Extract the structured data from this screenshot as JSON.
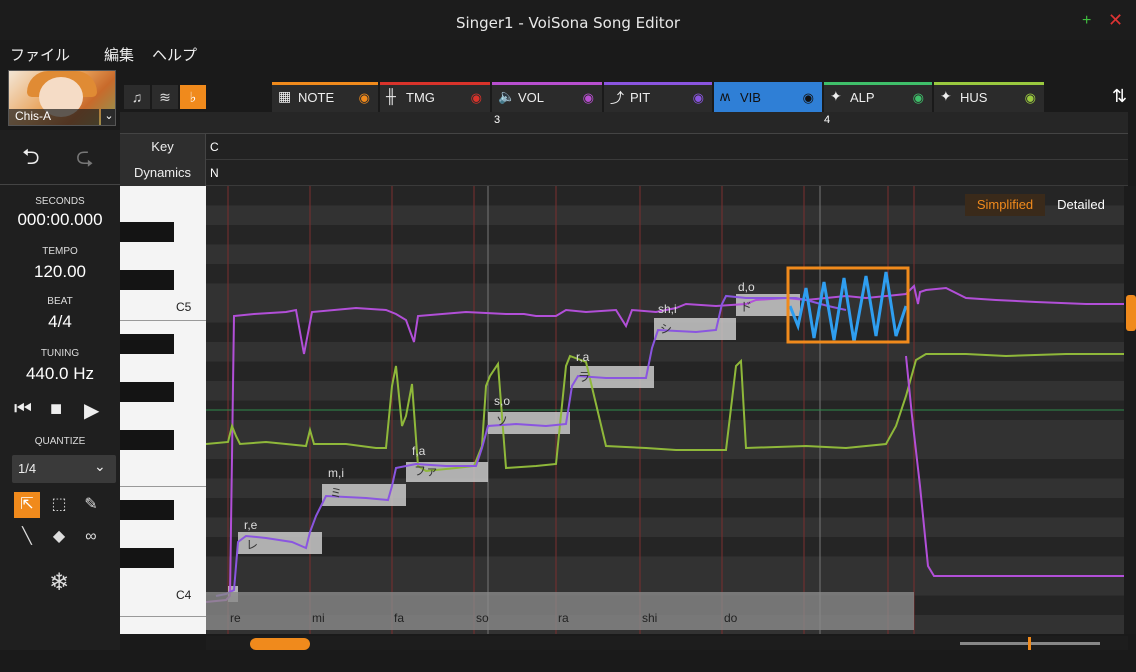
{
  "window": {
    "title": "Singer1 - VoiSona Song Editor"
  },
  "menu": [
    "ファイル",
    "編集",
    "ヘルプ"
  ],
  "singer": {
    "name": "Chis-A"
  },
  "history": {
    "undo_icon": "undo-icon",
    "redo_icon": "redo-icon"
  },
  "transport_info": {
    "seconds_label": "SECONDS",
    "seconds_value": "000:00.000",
    "tempo_label": "TEMPO",
    "tempo_value": "120.00",
    "beat_label": "BEAT",
    "beat_value": "4/4",
    "tuning_label": "TUNING",
    "tuning_value": "440.0 Hz"
  },
  "quantize": {
    "label": "QUANTIZE",
    "value": "1/4"
  },
  "tabs": [
    {
      "label": "NOTE",
      "color": "#f08a1c"
    },
    {
      "label": "TMG",
      "color": "#d9332b"
    },
    {
      "label": "VOL",
      "color": "#b84fd0"
    },
    {
      "label": "PIT",
      "color": "#8a55e0"
    },
    {
      "label": "VIB",
      "color": "#2f7fd6"
    },
    {
      "label": "ALP",
      "color": "#3fbf6a"
    },
    {
      "label": "HUS",
      "color": "#9ac93f"
    }
  ],
  "ruler": {
    "measures": [
      "3",
      "4"
    ]
  },
  "rows": {
    "key_label": "Key",
    "key_value": "C",
    "dyn_label": "Dynamics",
    "dyn_value": "N"
  },
  "piano": {
    "c5": "C5",
    "c4": "C4"
  },
  "view_toggle": {
    "simplified": "Simplified",
    "detailed": "Detailed"
  },
  "notes": [
    {
      "phoneme": "r,e",
      "kana": "レ"
    },
    {
      "phoneme": "m,i",
      "kana": "ミ"
    },
    {
      "phoneme": "f,a",
      "kana": "ファ"
    },
    {
      "phoneme": "s,o",
      "kana": "ソ"
    },
    {
      "phoneme": "r,a",
      "kana": "ラ"
    },
    {
      "phoneme": "sh,i",
      "kana": "シ"
    },
    {
      "phoneme": "d,o",
      "kana": "ド"
    }
  ],
  "lyrics_track": [
    "re",
    "mi",
    "fa",
    "so",
    "ra",
    "shi",
    "do"
  ],
  "colors": {
    "accent": "#f08a1c",
    "pitch": "#b24fd8",
    "vib": "#2f9ef0",
    "alp": "#8fb83a"
  }
}
